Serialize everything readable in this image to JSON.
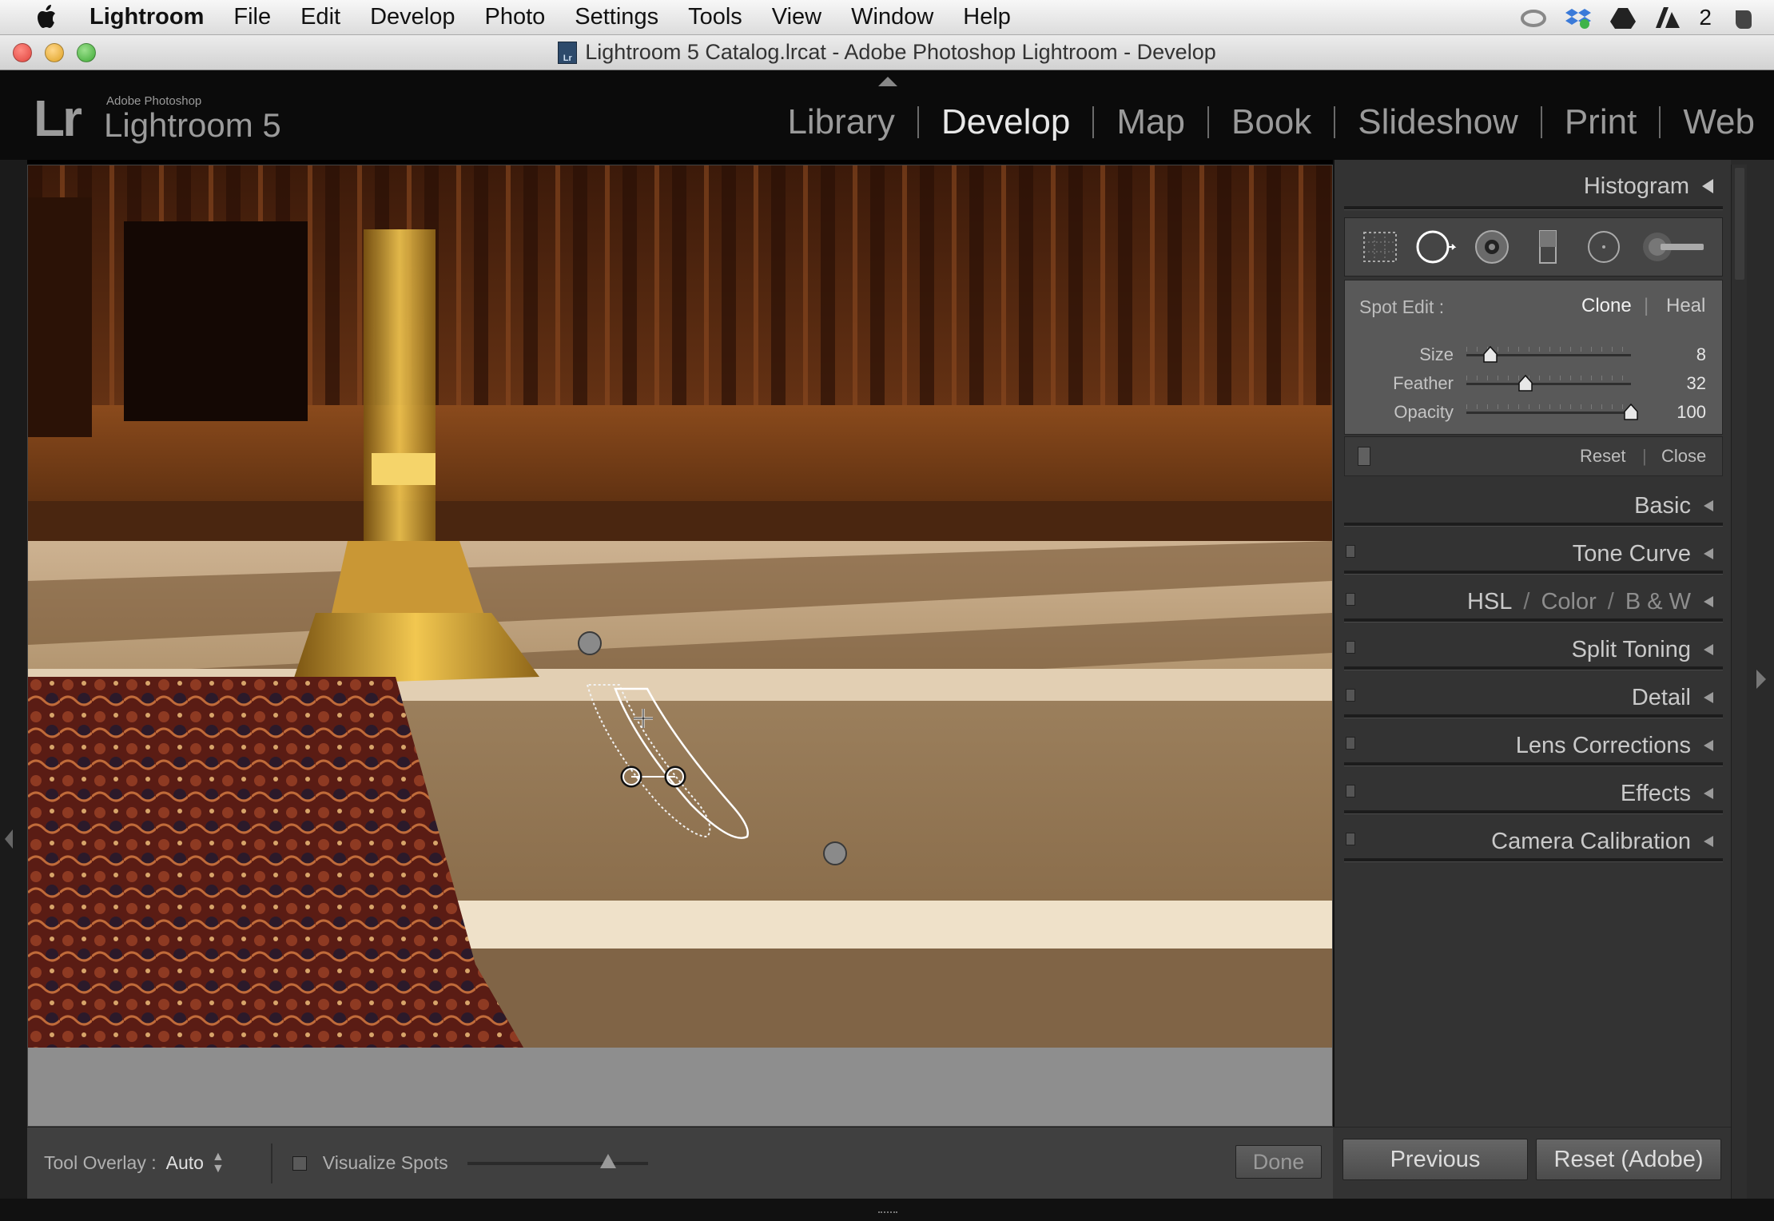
{
  "menubar": {
    "app": "Lightroom",
    "items": [
      "File",
      "Edit",
      "Develop",
      "Photo",
      "Settings",
      "Tools",
      "View",
      "Window",
      "Help"
    ],
    "tray_count": "2"
  },
  "window": {
    "title": "Lightroom 5 Catalog.lrcat - Adobe Photoshop Lightroom - Develop",
    "doc_icon_label": "Lr"
  },
  "identity": {
    "logo": "Lr",
    "subtitle": "Adobe Photoshop",
    "name": "Lightroom 5"
  },
  "modules": [
    "Library",
    "Develop",
    "Map",
    "Book",
    "Slideshow",
    "Print",
    "Web"
  ],
  "active_module": "Develop",
  "toolbar": {
    "tool_overlay_label": "Tool Overlay :",
    "tool_overlay_value": "Auto",
    "visualize_label": "Visualize Spots",
    "visualize_level": 0.78,
    "done_label": "Done"
  },
  "right_panel": {
    "histogram_label": "Histogram",
    "tools": [
      "crop-overlay-tool",
      "spot-removal-tool",
      "red-eye-tool",
      "graduated-filter-tool",
      "radial-filter-tool",
      "adjustment-brush-tool"
    ],
    "spot_edit": {
      "label": "Spot Edit :",
      "clone": "Clone",
      "separator": "|",
      "heal": "Heal",
      "size": {
        "label": "Size",
        "value": "8"
      },
      "feather": {
        "label": "Feather",
        "value": "32"
      },
      "opacity": {
        "label": "Opacity",
        "value": "100"
      }
    },
    "reset_label": "Reset",
    "close_label": "Close",
    "panels": {
      "basic": "Basic",
      "tone_curve": "Tone Curve",
      "hsl": "HSL",
      "color": "Color",
      "bw": "B & W",
      "split_toning": "Split Toning",
      "detail": "Detail",
      "lens_corrections": "Lens Corrections",
      "effects": "Effects",
      "camera_calibration": "Camera Calibration"
    },
    "slash": "/",
    "previous_label": "Previous",
    "reset_adobe_label": "Reset (Adobe)"
  },
  "colors": {
    "panel_bg": "#333333",
    "spot_box_bg": "#595959",
    "module_active": "#e8e8e8",
    "module_inactive": "#9a9a9a"
  }
}
